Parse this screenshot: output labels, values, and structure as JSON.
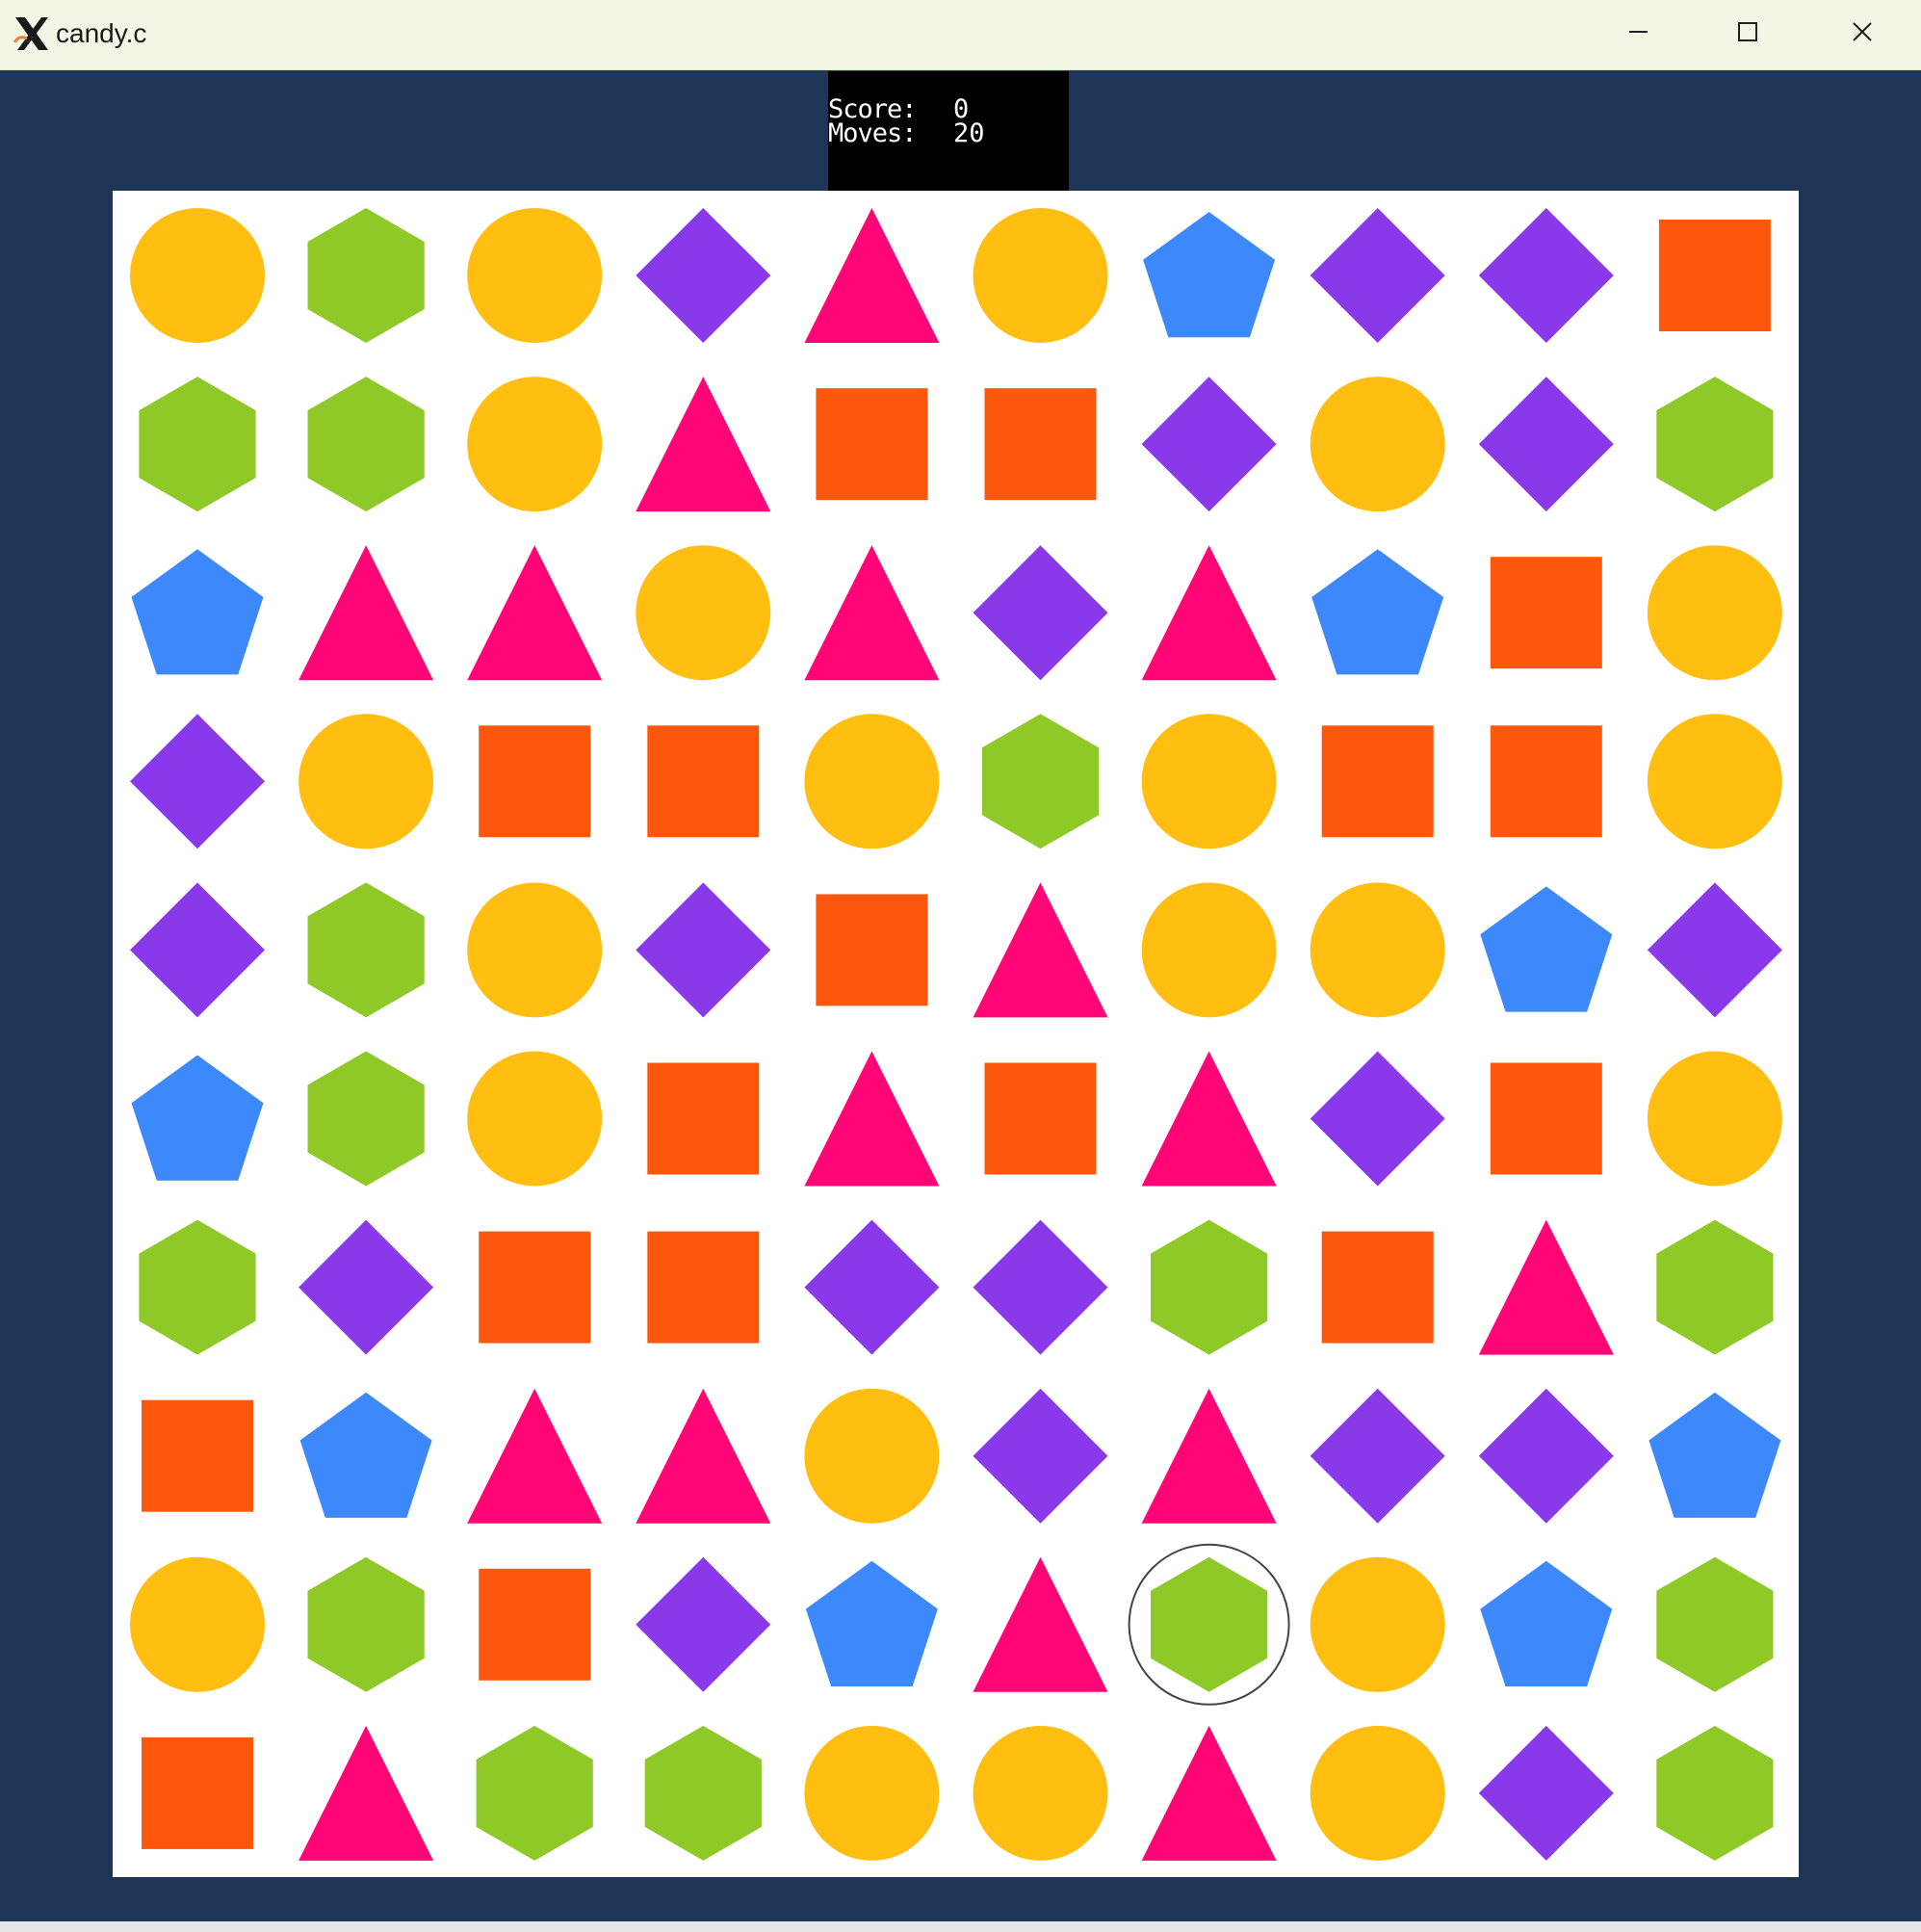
{
  "window": {
    "title": "candy.c",
    "app_icon": "x11-icon",
    "controls": [
      "minimize-icon",
      "maximize-icon",
      "close-icon"
    ]
  },
  "hud": {
    "score_label": "Score:",
    "score_value": "0",
    "moves_label": "Moves:",
    "moves_value": "20"
  },
  "colors": {
    "background": "#1f3557",
    "board": "#ffffff",
    "circle": "#ffbe10",
    "hexagon": "#8ec928",
    "diamond": "#8a39ea",
    "triangle": "#ff0677",
    "pentagon": "#3d89fb",
    "square": "#fd570c",
    "selection": "#444444"
  },
  "board": {
    "rows": 10,
    "cols": 10,
    "grid": [
      [
        "circle",
        "hexagon",
        "circle",
        "diamond",
        "triangle",
        "circle",
        "pentagon",
        "diamond",
        "diamond",
        "square"
      ],
      [
        "hexagon",
        "hexagon",
        "circle",
        "triangle",
        "square",
        "square",
        "diamond",
        "circle",
        "diamond",
        "hexagon"
      ],
      [
        "pentagon",
        "triangle",
        "triangle",
        "circle",
        "triangle",
        "diamond",
        "triangle",
        "pentagon",
        "square",
        "circle"
      ],
      [
        "diamond",
        "circle",
        "square",
        "square",
        "circle",
        "hexagon",
        "circle",
        "square",
        "square",
        "circle"
      ],
      [
        "diamond",
        "hexagon",
        "circle",
        "diamond",
        "square",
        "triangle",
        "circle",
        "circle",
        "pentagon",
        "diamond"
      ],
      [
        "pentagon",
        "hexagon",
        "circle",
        "square",
        "triangle",
        "square",
        "triangle",
        "diamond",
        "square",
        "circle"
      ],
      [
        "hexagon",
        "diamond",
        "square",
        "square",
        "diamond",
        "diamond",
        "hexagon",
        "square",
        "triangle",
        "hexagon"
      ],
      [
        "square",
        "pentagon",
        "triangle",
        "triangle",
        "circle",
        "diamond",
        "triangle",
        "diamond",
        "diamond",
        "pentagon"
      ],
      [
        "circle",
        "hexagon",
        "square",
        "diamond",
        "pentagon",
        "triangle",
        "hexagon",
        "circle",
        "pentagon",
        "hexagon"
      ],
      [
        "square",
        "triangle",
        "hexagon",
        "hexagon",
        "circle",
        "circle",
        "triangle",
        "circle",
        "diamond",
        "hexagon"
      ]
    ],
    "selected": {
      "row": 8,
      "col": 6
    }
  }
}
